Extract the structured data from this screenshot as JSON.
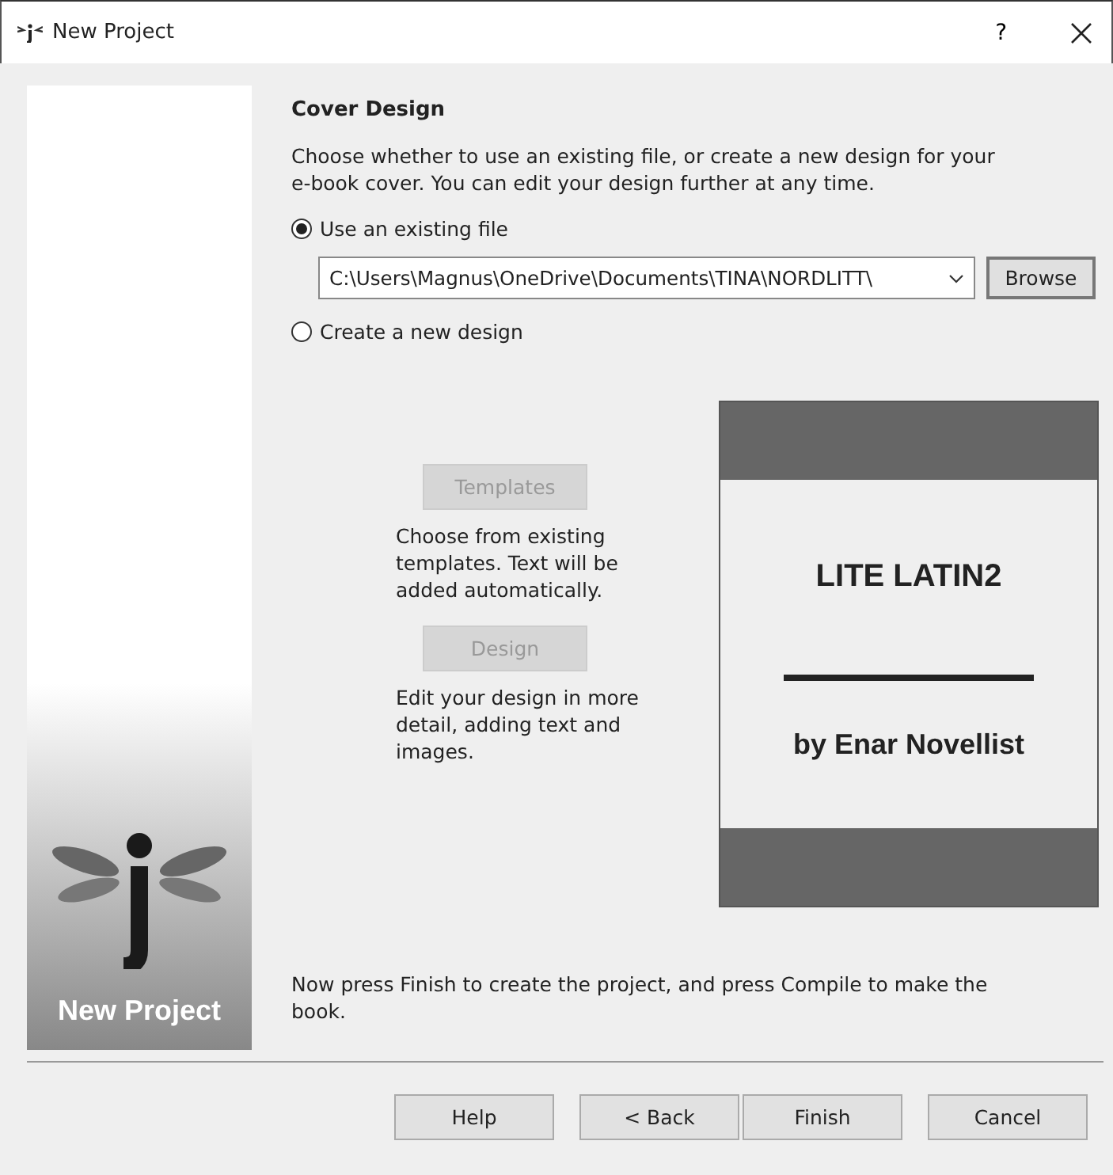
{
  "window": {
    "title": "New Project",
    "help": "?"
  },
  "sidebar": {
    "caption": "New Project"
  },
  "heading": "Cover Design",
  "intro": "Choose whether to use an existing file, or create a new design for your e-book cover. You can edit your design further at any time.",
  "options": [
    {
      "label": "Use an existing file",
      "selected": true
    },
    {
      "label": "Create a new design",
      "selected": false
    }
  ],
  "file_path": {
    "value": "C:\\Users\\Magnus\\OneDrive\\Documents\\TINA\\NORDLITT\\",
    "browse": "Browse"
  },
  "design_actions": [
    {
      "label": "Templates",
      "disabled": true,
      "description": "Choose from existing templates. Text will be added automatically."
    },
    {
      "label": "Design",
      "disabled": true,
      "description": "Edit your design in more detail, adding text and images."
    }
  ],
  "cover_preview": {
    "title": "LITE LATIN2",
    "author": "by Enar Novellist"
  },
  "footer_note": "Now press Finish to create the project, and press Compile to make the book.",
  "buttons": [
    {
      "label": "Help"
    },
    {
      "label": "< Back"
    },
    {
      "label": "Finish"
    },
    {
      "label": "Cancel"
    }
  ]
}
